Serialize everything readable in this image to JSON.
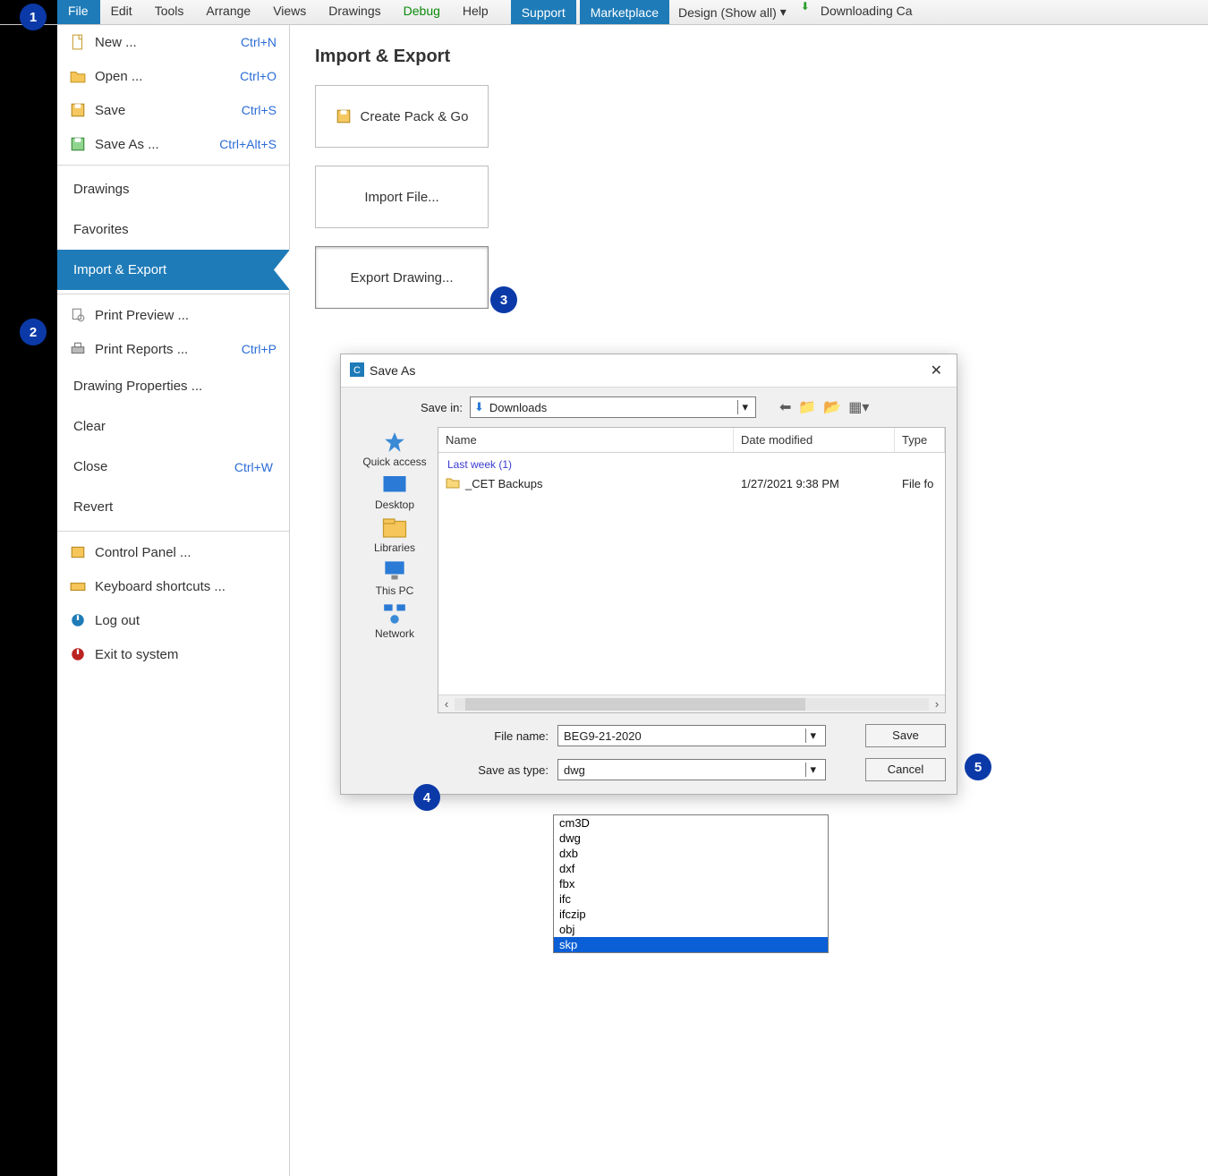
{
  "menubar": {
    "items": [
      "File",
      "Edit",
      "Tools",
      "Arrange",
      "Views",
      "Drawings",
      "Debug",
      "Help"
    ],
    "support": "Support",
    "marketplace": "Marketplace",
    "design": "Design (Show all)",
    "downloading": "Downloading Ca"
  },
  "filemenu": {
    "new": "New ...",
    "new_sc": "Ctrl+N",
    "open": "Open ...",
    "open_sc": "Ctrl+O",
    "save": "Save",
    "save_sc": "Ctrl+S",
    "saveas": "Save As ...",
    "saveas_sc": "Ctrl+Alt+S",
    "drawings": "Drawings",
    "favorites": "Favorites",
    "import_export": "Import & Export",
    "print_preview": "Print Preview ...",
    "print_reports": "Print Reports ...",
    "print_reports_sc": "Ctrl+P",
    "drawing_props": "Drawing Properties ...",
    "clear": "Clear",
    "close": "Close",
    "close_sc": "Ctrl+W",
    "revert": "Revert",
    "control_panel": "Control Panel ...",
    "kbd_shortcuts": "Keyboard shortcuts ...",
    "logout": "Log out",
    "exit": "Exit to system"
  },
  "main": {
    "heading": "Import & Export",
    "create_pack": "Create Pack & Go",
    "import_file": "Import File...",
    "export_drawing": "Export Drawing..."
  },
  "dialog": {
    "title": "Save As",
    "save_in_lbl": "Save in:",
    "save_in_val": "Downloads",
    "cols": {
      "name": "Name",
      "date": "Date modified",
      "type": "Type"
    },
    "group": "Last week (1)",
    "row": {
      "name": "_CET Backups",
      "date": "1/27/2021 9:38 PM",
      "type": "File fo"
    },
    "filename_lbl": "File name:",
    "filename_val": "BEG9-21-2020",
    "savetype_lbl": "Save as type:",
    "savetype_val": "dwg",
    "save_btn": "Save",
    "cancel_btn": "Cancel",
    "places": {
      "quick": "Quick access",
      "desktop": "Desktop",
      "libraries": "Libraries",
      "thispc": "This PC",
      "network": "Network"
    },
    "options": [
      "cm3D",
      "dwg",
      "dxb",
      "dxf",
      "fbx",
      "ifc",
      "ifczip",
      "obj",
      "skp"
    ],
    "selected_option": "skp"
  },
  "callouts": {
    "c1": "1",
    "c2": "2",
    "c3": "3",
    "c4": "4",
    "c5": "5"
  }
}
